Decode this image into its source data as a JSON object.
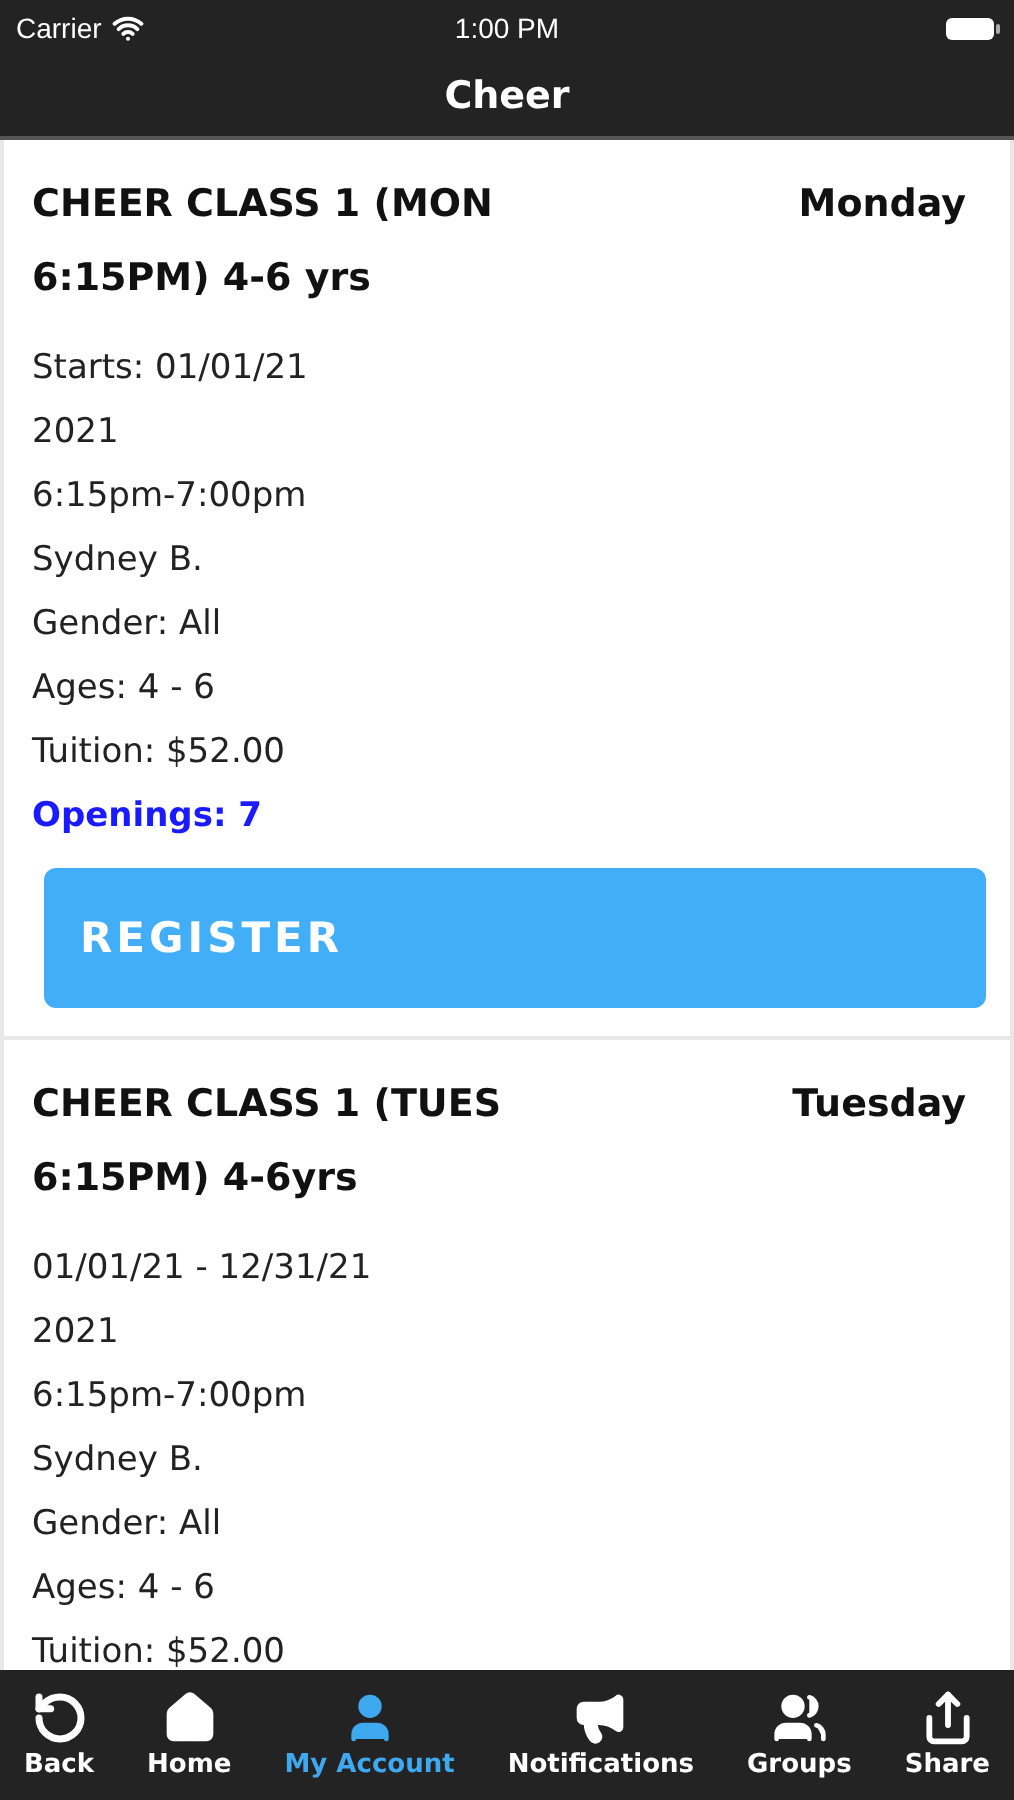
{
  "status_bar": {
    "carrier": "Carrier",
    "time": "1:00 PM"
  },
  "nav_bar": {
    "title": "Cheer"
  },
  "classes": [
    {
      "title": "CHEER CLASS 1 (MON 6:15PM) 4-6 yrs",
      "day": "Monday",
      "details": [
        "Starts: 01/01/21",
        "2021",
        "6:15pm-7:00pm",
        "Sydney B.",
        "Gender: All",
        "Ages: 4 - 6",
        "Tuition: $52.00"
      ],
      "openings": "Openings: 7",
      "button": "REGISTER"
    },
    {
      "title": "CHEER CLASS 1 (TUES 6:15PM) 4-6yrs",
      "day": "Tuesday",
      "details": [
        "01/01/21 - 12/31/21",
        "2021",
        "6:15pm-7:00pm",
        "Sydney B.",
        "Gender: All",
        "Ages: 4 - 6",
        "Tuition: $52.00"
      ]
    }
  ],
  "tab_bar": [
    {
      "kind": "back",
      "label": "Back",
      "selected": false
    },
    {
      "kind": "home",
      "label": "Home",
      "selected": false
    },
    {
      "kind": "account",
      "label": "My Account",
      "selected": true
    },
    {
      "kind": "notifications",
      "label": "Notifications",
      "selected": false
    },
    {
      "kind": "groups",
      "label": "Groups",
      "selected": false
    },
    {
      "kind": "share",
      "label": "Share",
      "selected": false
    }
  ]
}
